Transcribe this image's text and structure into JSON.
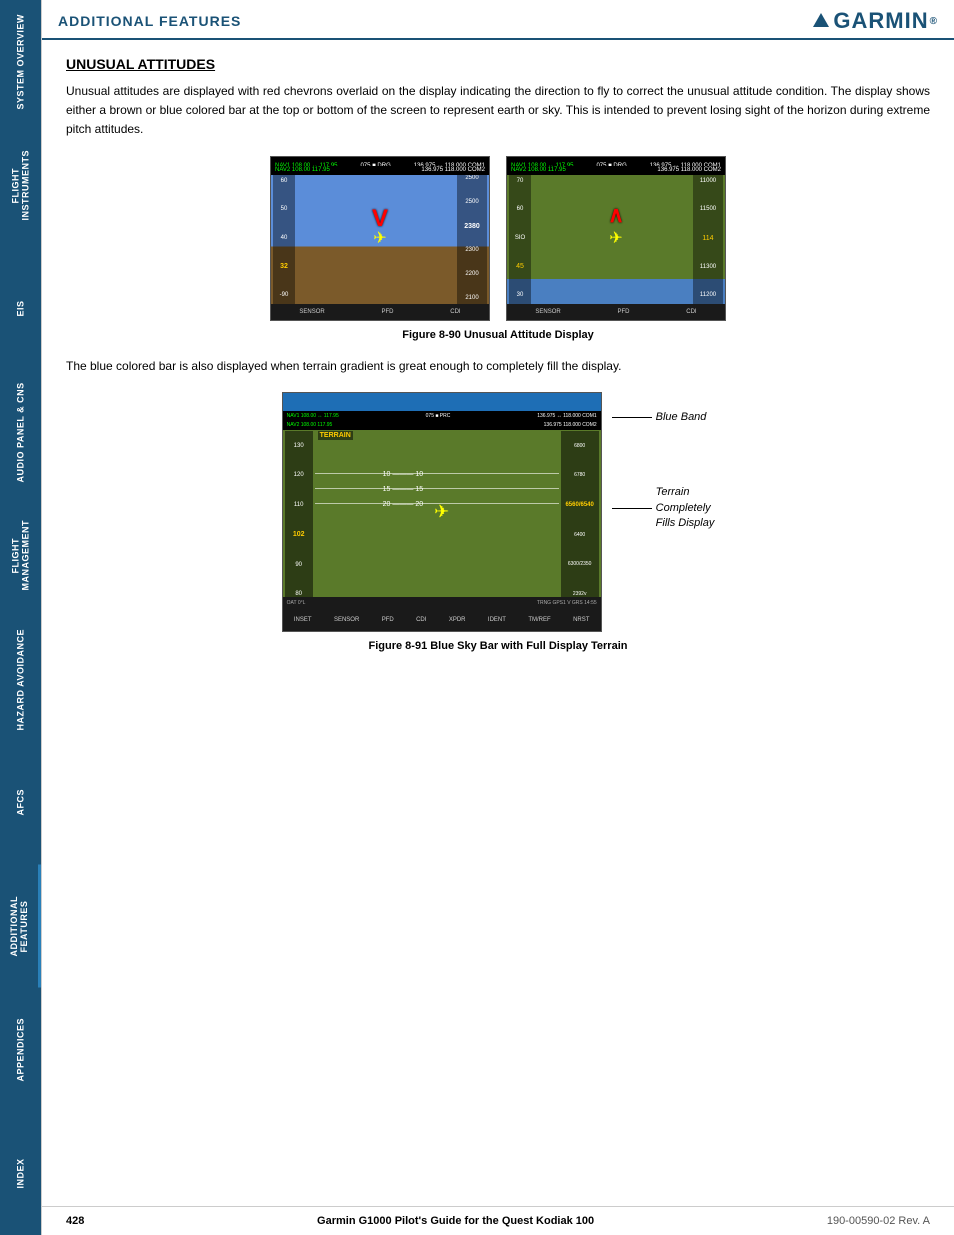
{
  "header": {
    "title": "ADDITIONAL FEATURES",
    "logo": "GARMIN"
  },
  "sidebar": {
    "items": [
      {
        "id": "system-overview",
        "label": "SYSTEM OVERVIEW"
      },
      {
        "id": "flight-instruments",
        "label": "FLIGHT INSTRUMENTS"
      },
      {
        "id": "eis",
        "label": "EIS"
      },
      {
        "id": "audio-panel",
        "label": "AUDIO PANEL & CNS"
      },
      {
        "id": "flight-management",
        "label": "FLIGHT MANAGEMENT"
      },
      {
        "id": "hazard-avoidance",
        "label": "HAZARD AVOIDANCE"
      },
      {
        "id": "afcs",
        "label": "AFCS"
      },
      {
        "id": "additional-features",
        "label": "ADDITIONAL FEATURES",
        "active": true
      },
      {
        "id": "appendices",
        "label": "APPENDICES"
      },
      {
        "id": "index",
        "label": "INDEX"
      }
    ]
  },
  "section": {
    "title": "UNUSUAL ATTITUDES",
    "body_text": "Unusual attitudes are displayed with red chevrons overlaid on the display indicating the direction to fly to correct the unusual attitude condition.  The display shows either a brown or blue colored bar at the top or bottom of the screen to represent earth or sky.  This is intended to prevent losing sight of the horizon during extreme pitch attitudes.",
    "figure1_caption": "Figure 8-90  Unusual Attitude Display",
    "body_text2": "The blue colored bar is also displayed when terrain gradient is great enough to completely fill the display.",
    "annotation_blue_band": "Blue Band",
    "annotation_terrain": "Terrain\nCompletely\nFills Display",
    "figure2_caption": "Figure 8-91  Blue Sky Bar with Full Display Terrain"
  },
  "footer": {
    "page_number": "428",
    "title": "Garmin G1000 Pilot's Guide for the Quest Kodiak 100",
    "revision": "190-00590-02  Rev. A"
  }
}
